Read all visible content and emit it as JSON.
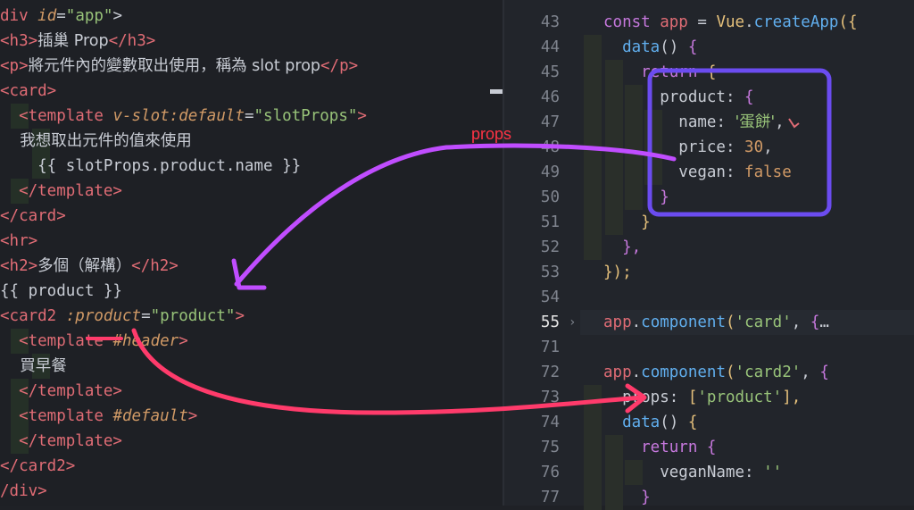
{
  "left_code": {
    "lines": [
      [
        {
          "t": "div ",
          "c": "tag"
        },
        {
          "t": "id",
          "c": "attr"
        },
        {
          "t": "=",
          "c": "plain"
        },
        {
          "t": "\"app\"",
          "c": "str"
        },
        {
          "t": ">",
          "c": "plain"
        }
      ],
      [
        {
          "t": "<h3>",
          "c": "tag"
        },
        {
          "t": "插巢 Prop",
          "c": "plain"
        },
        {
          "t": "</h3>",
          "c": "tag"
        }
      ],
      [
        {
          "t": "<p>",
          "c": "tag"
        },
        {
          "t": "將元件內的變數取出使用，稱為 slot prop",
          "c": "plain"
        },
        {
          "t": "</p>",
          "c": "tag"
        }
      ],
      [
        {
          "t": "<card>",
          "c": "tag"
        }
      ],
      [
        {
          "t": "  <template ",
          "c": "tag"
        },
        {
          "t": "v-slot:default",
          "c": "attr"
        },
        {
          "t": "=",
          "c": "plain"
        },
        {
          "t": "\"slotProps\"",
          "c": "str"
        },
        {
          "t": ">",
          "c": "tag"
        }
      ],
      [
        {
          "t": "    我想取出元件的值來使用",
          "c": "plain"
        }
      ],
      [
        {
          "t": "    {{ slotProps.product.name }}",
          "c": "plain"
        }
      ],
      [
        {
          "t": "  </template>",
          "c": "tag"
        }
      ],
      [
        {
          "t": "</card>",
          "c": "tag"
        }
      ],
      [
        {
          "t": "<hr>",
          "c": "tag"
        }
      ],
      [
        {
          "t": "<h2>",
          "c": "tag"
        },
        {
          "t": "多個（解構）",
          "c": "plain"
        },
        {
          "t": "</h2>",
          "c": "tag"
        }
      ],
      [
        {
          "t": "{{ product }}",
          "c": "plain"
        }
      ],
      [
        {
          "t": "<card2 ",
          "c": "tag"
        },
        {
          "t": ":product",
          "c": "attr"
        },
        {
          "t": "=",
          "c": "plain"
        },
        {
          "t": "\"product\"",
          "c": "str"
        },
        {
          "t": ">",
          "c": "tag"
        }
      ],
      [
        {
          "t": "  <template ",
          "c": "tag"
        },
        {
          "t": "#header",
          "c": "attr"
        },
        {
          "t": ">",
          "c": "tag"
        }
      ],
      [
        {
          "t": "    買早餐",
          "c": "plain"
        }
      ],
      [
        {
          "t": "  </template>",
          "c": "tag"
        }
      ],
      [
        {
          "t": "  <template ",
          "c": "tag"
        },
        {
          "t": "#default",
          "c": "attr"
        },
        {
          "t": ">",
          "c": "tag"
        }
      ],
      [
        {
          "t": "  </template>",
          "c": "tag"
        }
      ],
      [
        {
          "t": "</card2>",
          "c": "tag"
        }
      ],
      [
        {
          "t": "/div>",
          "c": "tag"
        }
      ]
    ]
  },
  "right_code": {
    "lines": [
      {
        "n": "43",
        "segs": [
          {
            "t": "const ",
            "c": "kw"
          },
          {
            "t": "app ",
            "c": "tag"
          },
          {
            "t": "= ",
            "c": "plain"
          },
          {
            "t": "Vue",
            "c": "prop"
          },
          {
            "t": ".",
            "c": "plain"
          },
          {
            "t": "createApp",
            "c": "fn"
          },
          {
            "t": "({",
            "c": "br1"
          }
        ]
      },
      {
        "n": "44",
        "segs": [
          {
            "t": "  data",
            "c": "fn"
          },
          {
            "t": "() ",
            "c": "plain"
          },
          {
            "t": "{",
            "c": "br2"
          }
        ]
      },
      {
        "n": "45",
        "segs": [
          {
            "t": "    return ",
            "c": "kw"
          },
          {
            "t": "{",
            "c": "br1"
          }
        ]
      },
      {
        "n": "46",
        "segs": [
          {
            "t": "      product",
            "c": "plain"
          },
          {
            "t": ": ",
            "c": "plain"
          },
          {
            "t": "{",
            "c": "br2"
          }
        ]
      },
      {
        "n": "47",
        "segs": [
          {
            "t": "        name",
            "c": "plain"
          },
          {
            "t": ": ",
            "c": "plain"
          },
          {
            "t": "'蛋餅'",
            "c": "str"
          },
          {
            "t": ",",
            "c": "plain"
          }
        ]
      },
      {
        "n": "48",
        "segs": [
          {
            "t": "        price",
            "c": "plain"
          },
          {
            "t": ": ",
            "c": "plain"
          },
          {
            "t": "30",
            "c": "num"
          },
          {
            "t": ",",
            "c": "plain"
          }
        ]
      },
      {
        "n": "49",
        "segs": [
          {
            "t": "        vegan",
            "c": "plain"
          },
          {
            "t": ": ",
            "c": "plain"
          },
          {
            "t": "false",
            "c": "num"
          }
        ]
      },
      {
        "n": "50",
        "segs": [
          {
            "t": "      }",
            "c": "br2"
          }
        ]
      },
      {
        "n": "51",
        "segs": [
          {
            "t": "    }",
            "c": "br1"
          }
        ]
      },
      {
        "n": "52",
        "segs": [
          {
            "t": "  },",
            "c": "br2"
          }
        ]
      },
      {
        "n": "53",
        "segs": [
          {
            "t": "});",
            "c": "br1"
          }
        ]
      },
      {
        "n": "54",
        "segs": []
      },
      {
        "n": "55",
        "segs": [
          {
            "t": "app",
            "c": "tag"
          },
          {
            "t": ".",
            "c": "plain"
          },
          {
            "t": "component",
            "c": "fn"
          },
          {
            "t": "(",
            "c": "br1"
          },
          {
            "t": "'card'",
            "c": "str"
          },
          {
            "t": ", ",
            "c": "plain"
          },
          {
            "t": "{",
            "c": "br2"
          },
          {
            "t": "…",
            "c": "plain"
          }
        ]
      },
      {
        "n": "71",
        "segs": []
      },
      {
        "n": "72",
        "segs": [
          {
            "t": "app",
            "c": "tag"
          },
          {
            "t": ".",
            "c": "plain"
          },
          {
            "t": "component",
            "c": "fn"
          },
          {
            "t": "(",
            "c": "br1"
          },
          {
            "t": "'card2'",
            "c": "str"
          },
          {
            "t": ", ",
            "c": "plain"
          },
          {
            "t": "{",
            "c": "br2"
          }
        ]
      },
      {
        "n": "73",
        "segs": [
          {
            "t": "  props",
            "c": "plain"
          },
          {
            "t": ": ",
            "c": "plain"
          },
          {
            "t": "[",
            "c": "br1"
          },
          {
            "t": "'product'",
            "c": "str"
          },
          {
            "t": "],",
            "c": "br1"
          }
        ]
      },
      {
        "n": "74",
        "segs": [
          {
            "t": "  data",
            "c": "fn"
          },
          {
            "t": "() ",
            "c": "plain"
          },
          {
            "t": "{",
            "c": "br1"
          }
        ]
      },
      {
        "n": "75",
        "segs": [
          {
            "t": "    return ",
            "c": "kw"
          },
          {
            "t": "{",
            "c": "br2"
          }
        ]
      },
      {
        "n": "76",
        "segs": [
          {
            "t": "      veganName",
            "c": "plain"
          },
          {
            "t": ": ",
            "c": "plain"
          },
          {
            "t": "''",
            "c": "str"
          }
        ]
      },
      {
        "n": "77",
        "segs": [
          {
            "t": "    }",
            "c": "br2"
          }
        ]
      }
    ]
  },
  "annotation": {
    "label": "props",
    "colors": {
      "label": "#ff3344",
      "box": "#6b4cf0",
      "arrow_a": "#c04dff",
      "arrow_b": "#ff3b6b"
    }
  }
}
